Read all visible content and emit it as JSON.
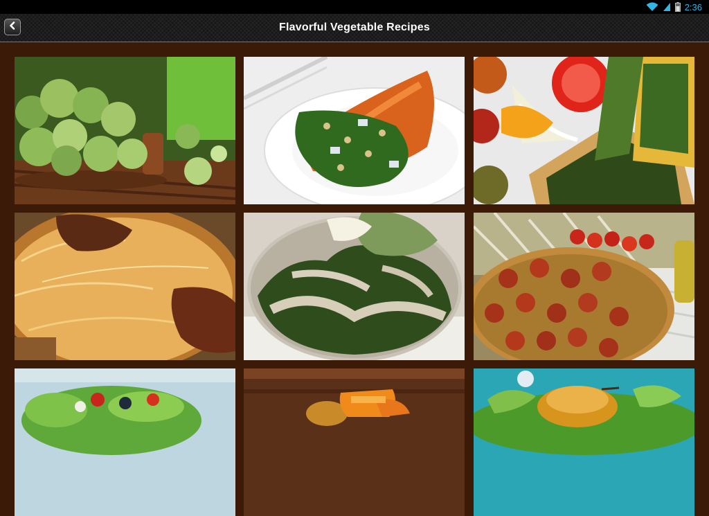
{
  "status_bar": {
    "time": "2:36",
    "icons": [
      "wifi-icon",
      "cell-signal-icon",
      "battery-icon"
    ]
  },
  "header": {
    "title": "Flavorful Vegetable Recipes",
    "back_icon": "chevron-left-icon"
  },
  "colors": {
    "background": "#3b1a08",
    "status_accent": "#33b5e5"
  },
  "recipes": [
    {
      "image": "brussels-sprouts-photo"
    },
    {
      "image": "baked-squash-arugula-salad-photo"
    },
    {
      "image": "spinach-flatbread-photo"
    },
    {
      "image": "vermicelli-bake-photo"
    },
    {
      "image": "spinach-dumpling-photo"
    },
    {
      "image": "tomato-focaccia-photo"
    },
    {
      "image": "green-salad-photo"
    },
    {
      "image": "roasted-squash-photo"
    },
    {
      "image": "stuffed-pear-salad-photo"
    }
  ]
}
